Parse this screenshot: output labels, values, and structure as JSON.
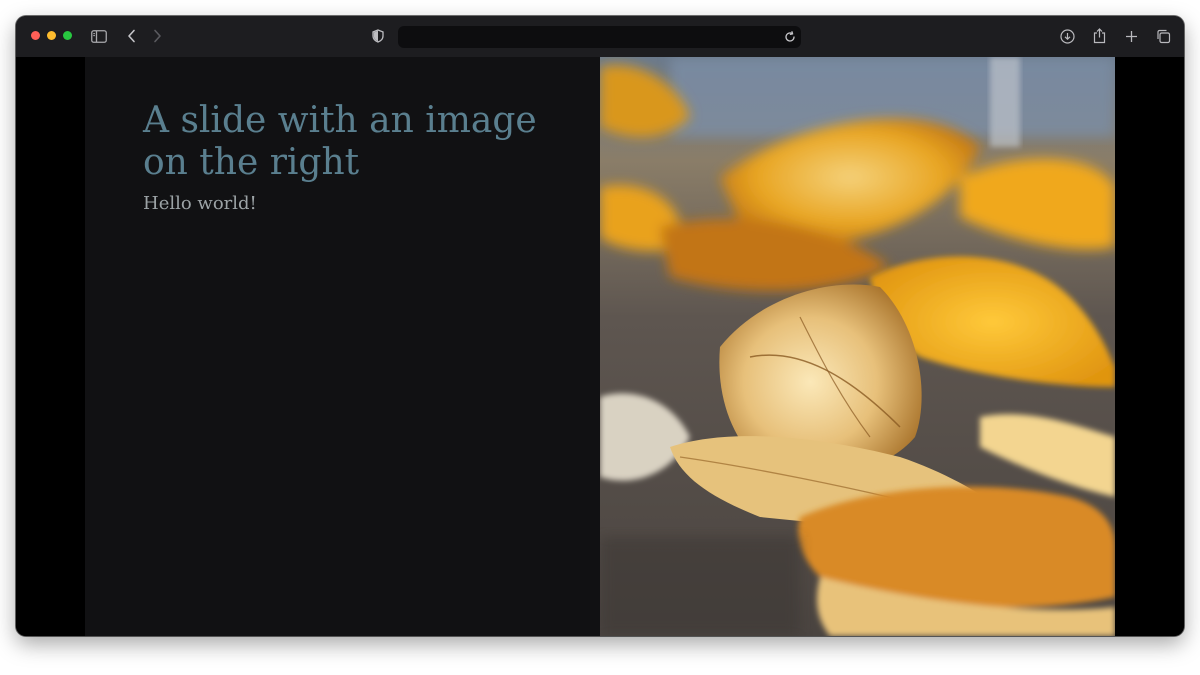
{
  "browser": {
    "traffic_lights": {
      "close": "#ff5f57",
      "minimize": "#febc2e",
      "zoom": "#28c840"
    },
    "icons": {
      "sidebar": "sidebar-icon",
      "back": "chevron-left-icon",
      "forward": "chevron-right-icon",
      "shield": "shield-icon",
      "reload": "reload-icon",
      "download": "download-icon",
      "share": "share-icon",
      "new_tab": "plus-icon",
      "tabs": "tabs-overview-icon"
    },
    "address": ""
  },
  "slide": {
    "title": "A slide with an image on the right",
    "subtitle": "Hello world!",
    "image_description": "",
    "colors": {
      "title": "#5a7f8f",
      "subtitle": "#9ca3a6",
      "background": "#111113"
    }
  }
}
